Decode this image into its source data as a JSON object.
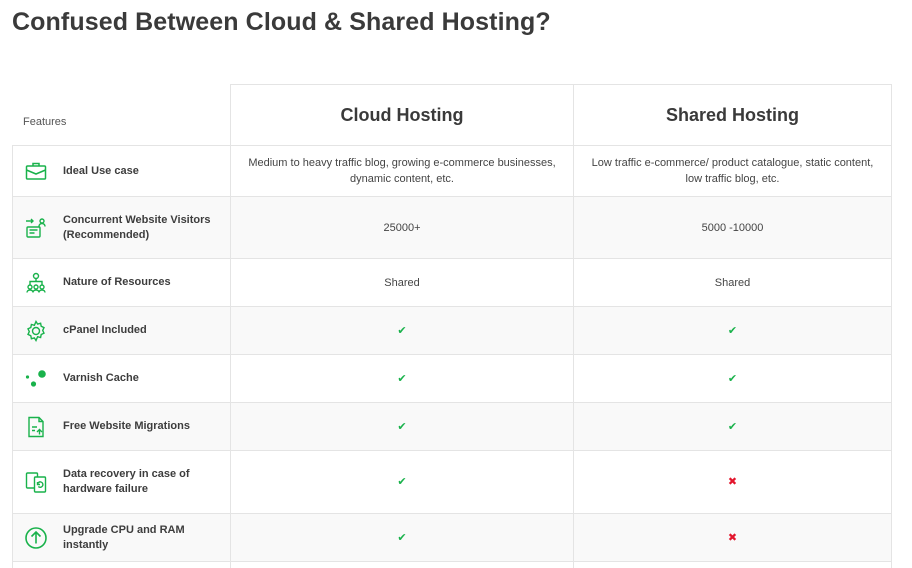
{
  "page": {
    "title": "Confused Between Cloud & Shared Hosting?"
  },
  "colors": {
    "accent_green": "#19b24b",
    "cross_red": "#e3162d",
    "border": "#e4e4e4",
    "row_stripe": "#f9f9f9"
  },
  "table": {
    "features_header": "Features",
    "cloud_header": "Cloud Hosting",
    "shared_header": "Shared Hosting",
    "rows": [
      {
        "icon": "briefcase-icon",
        "feature": "Ideal Use case",
        "cloud": "Medium to heavy traffic blog, growing e-commerce businesses, dynamic content, etc.",
        "shared": "Low traffic e-commerce/ product catalogue, static content, low traffic blog, etc."
      },
      {
        "icon": "visitors-icon",
        "feature": "Concurrent Website Visitors (Recommended)",
        "cloud": "25000+",
        "shared": "5000 -10000"
      },
      {
        "icon": "resources-icon",
        "feature": "Nature of Resources",
        "cloud": "Shared",
        "shared": "Shared"
      },
      {
        "icon": "gear-icon",
        "feature": "cPanel Included",
        "cloud": "✔",
        "shared": "✔"
      },
      {
        "icon": "dots-icon",
        "feature": "Varnish Cache",
        "cloud": "✔",
        "shared": "✔"
      },
      {
        "icon": "document-icon",
        "feature": "Free Website Migrations",
        "cloud": "✔",
        "shared": "✔"
      },
      {
        "icon": "recovery-icon",
        "feature": "Data recovery in case of hardware failure",
        "cloud": "✔",
        "shared": "✖"
      },
      {
        "icon": "upgrade-arrow-icon",
        "feature": "Upgrade CPU and RAM instantly",
        "cloud": "✔",
        "shared": "✖"
      }
    ]
  }
}
